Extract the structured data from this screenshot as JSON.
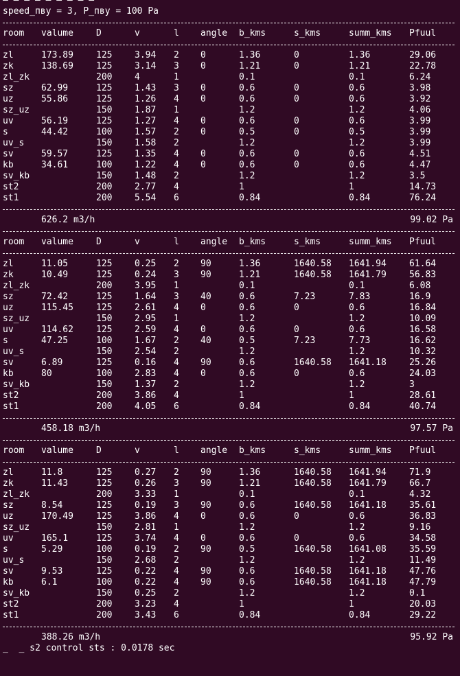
{
  "terminal": {
    "top_partial_line": "— — — — — — — — —",
    "header_line": "speed_пву = 3, P_пву = 100 Pa",
    "columns": [
      "room",
      "valume",
      "D",
      "v",
      "l",
      "angle",
      "b_kms",
      "s_kms",
      "summ_kms",
      "Pfuul"
    ],
    "tables": [
      {
        "rows": [
          [
            "zl",
            "173.89",
            "125",
            "3.94",
            "2",
            "0",
            "1.36",
            "0",
            "1.36",
            "29.06"
          ],
          [
            "zk",
            "138.69",
            "125",
            "3.14",
            "3",
            "0",
            "1.21",
            "0",
            "1.21",
            "22.78"
          ],
          [
            "zl_zk",
            "",
            "200",
            "4",
            "1",
            "",
            "0.1",
            "",
            "0.1",
            "6.24"
          ],
          [
            "sz",
            "62.99",
            "125",
            "1.43",
            "3",
            "0",
            "0.6",
            "0",
            "0.6",
            "3.98"
          ],
          [
            "uz",
            "55.86",
            "125",
            "1.26",
            "4",
            "0",
            "0.6",
            "0",
            "0.6",
            "3.92"
          ],
          [
            "sz_uz",
            "",
            "150",
            "1.87",
            "1",
            "",
            "1.2",
            "",
            "1.2",
            "4.06"
          ],
          [
            "uv",
            "56.19",
            "125",
            "1.27",
            "4",
            "0",
            "0.6",
            "0",
            "0.6",
            "3.99"
          ],
          [
            "s",
            "44.42",
            "100",
            "1.57",
            "2",
            "0",
            "0.5",
            "0",
            "0.5",
            "3.99"
          ],
          [
            "uv_s",
            "",
            "150",
            "1.58",
            "2",
            "",
            "1.2",
            "",
            "1.2",
            "3.99"
          ],
          [
            "sv",
            "59.57",
            "125",
            "1.35",
            "4",
            "0",
            "0.6",
            "0",
            "0.6",
            "4.51"
          ],
          [
            "kb",
            "34.61",
            "100",
            "1.22",
            "4",
            "0",
            "0.6",
            "0",
            "0.6",
            "4.47"
          ],
          [
            "sv_kb",
            "",
            "150",
            "1.48",
            "2",
            "",
            "1.2",
            "",
            "1.2",
            "3.5"
          ],
          [
            "st2",
            "",
            "200",
            "2.77",
            "4",
            "",
            "1",
            "",
            "1",
            "14.73"
          ],
          [
            "st1",
            "",
            "200",
            "5.54",
            "6",
            "",
            "0.84",
            "",
            "0.84",
            "76.24"
          ]
        ],
        "summary": {
          "flow": "626.2 m3/h",
          "pressure": "99.02 Pa"
        }
      },
      {
        "rows": [
          [
            "zl",
            "11.05",
            "125",
            "0.25",
            "2",
            "90",
            "1.36",
            "1640.58",
            "1641.94",
            "61.64"
          ],
          [
            "zk",
            "10.49",
            "125",
            "0.24",
            "3",
            "90",
            "1.21",
            "1640.58",
            "1641.79",
            "56.83"
          ],
          [
            "zl_zk",
            "",
            "200",
            "3.95",
            "1",
            "",
            "0.1",
            "",
            "0.1",
            "6.08"
          ],
          [
            "sz",
            "72.42",
            "125",
            "1.64",
            "3",
            "40",
            "0.6",
            "7.23",
            "7.83",
            "16.9"
          ],
          [
            "uz",
            "115.45",
            "125",
            "2.61",
            "4",
            "0",
            "0.6",
            "0",
            "0.6",
            "16.84"
          ],
          [
            "sz_uz",
            "",
            "150",
            "2.95",
            "1",
            "",
            "1.2",
            "",
            "1.2",
            "10.09"
          ],
          [
            "uv",
            "114.62",
            "125",
            "2.59",
            "4",
            "0",
            "0.6",
            "0",
            "0.6",
            "16.58"
          ],
          [
            "s",
            "47.25",
            "100",
            "1.67",
            "2",
            "40",
            "0.5",
            "7.23",
            "7.73",
            "16.62"
          ],
          [
            "uv_s",
            "",
            "150",
            "2.54",
            "2",
            "",
            "1.2",
            "",
            "1.2",
            "10.32"
          ],
          [
            "sv",
            "6.89",
            "125",
            "0.16",
            "4",
            "90",
            "0.6",
            "1640.58",
            "1641.18",
            "25.26"
          ],
          [
            "kb",
            "80",
            "100",
            "2.83",
            "4",
            "0",
            "0.6",
            "0",
            "0.6",
            "24.03"
          ],
          [
            "sv_kb",
            "",
            "150",
            "1.37",
            "2",
            "",
            "1.2",
            "",
            "1.2",
            "3"
          ],
          [
            "st2",
            "",
            "200",
            "3.86",
            "4",
            "",
            "1",
            "",
            "1",
            "28.61"
          ],
          [
            "st1",
            "",
            "200",
            "4.05",
            "6",
            "",
            "0.84",
            "",
            "0.84",
            "40.74"
          ]
        ],
        "summary": {
          "flow": "458.18 m3/h",
          "pressure": "97.57 Pa"
        }
      },
      {
        "rows": [
          [
            "zl",
            "11.8",
            "125",
            "0.27",
            "2",
            "90",
            "1.36",
            "1640.58",
            "1641.94",
            "71.9"
          ],
          [
            "zk",
            "11.43",
            "125",
            "0.26",
            "3",
            "90",
            "1.21",
            "1640.58",
            "1641.79",
            "66.7"
          ],
          [
            "zl_zk",
            "",
            "200",
            "3.33",
            "1",
            "",
            "0.1",
            "",
            "0.1",
            "4.32"
          ],
          [
            "sz",
            "8.54",
            "125",
            "0.19",
            "3",
            "90",
            "0.6",
            "1640.58",
            "1641.18",
            "35.61"
          ],
          [
            "uz",
            "170.49",
            "125",
            "3.86",
            "4",
            "0",
            "0.6",
            "0",
            "0.6",
            "36.83"
          ],
          [
            "sz_uz",
            "",
            "150",
            "2.81",
            "1",
            "",
            "1.2",
            "",
            "1.2",
            "9.16"
          ],
          [
            "uv",
            "165.1",
            "125",
            "3.74",
            "4",
            "0",
            "0.6",
            "0",
            "0.6",
            "34.58"
          ],
          [
            "s",
            "5.29",
            "100",
            "0.19",
            "2",
            "90",
            "0.5",
            "1640.58",
            "1641.08",
            "35.59"
          ],
          [
            "uv_s",
            "",
            "150",
            "2.68",
            "2",
            "",
            "1.2",
            "",
            "1.2",
            "11.49"
          ],
          [
            "sv",
            "9.53",
            "125",
            "0.22",
            "4",
            "90",
            "0.6",
            "1640.58",
            "1641.18",
            "47.76"
          ],
          [
            "kb",
            "6.1",
            "100",
            "0.22",
            "4",
            "90",
            "0.6",
            "1640.58",
            "1641.18",
            "47.79"
          ],
          [
            "sv_kb",
            "",
            "150",
            "0.25",
            "2",
            "",
            "1.2",
            "",
            "1.2",
            "0.1"
          ],
          [
            "st2",
            "",
            "200",
            "3.23",
            "4",
            "",
            "1",
            "",
            "1",
            "20.03"
          ],
          [
            "st1",
            "",
            "200",
            "3.43",
            "6",
            "",
            "0.84",
            "",
            "0.84",
            "29.22"
          ]
        ],
        "summary": {
          "flow": "388.26 m3/h",
          "pressure": "95.92 Pa"
        }
      }
    ],
    "bottom_partial_line": "_  _ s2 control sts : 0.0178 sec"
  },
  "colors": {
    "background": "#300a24",
    "text": "#ffffff"
  }
}
